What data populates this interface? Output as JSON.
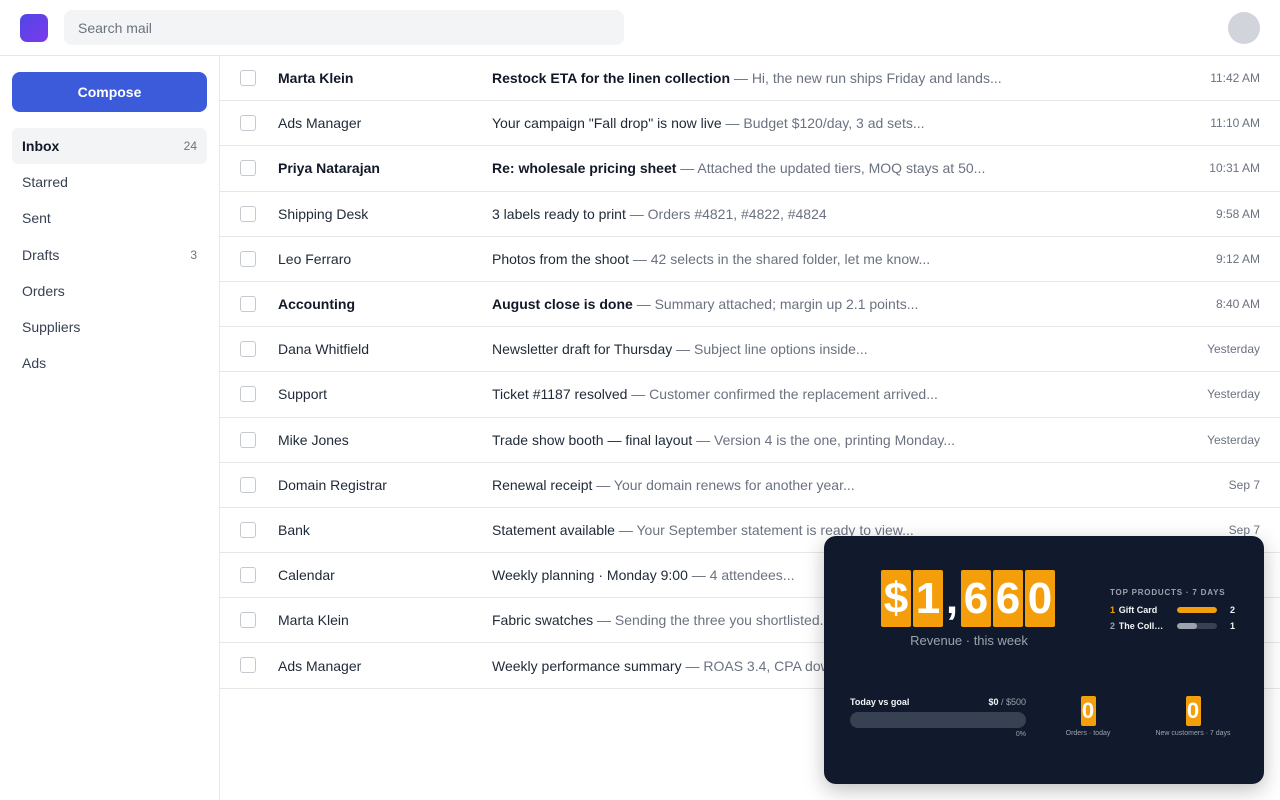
{
  "search": {
    "placeholder": "Search mail"
  },
  "sidebar": {
    "compose_label": "Compose",
    "items": [
      {
        "label": "Inbox",
        "count": "24"
      },
      {
        "label": "Starred",
        "count": ""
      },
      {
        "label": "Sent",
        "count": ""
      },
      {
        "label": "Drafts",
        "count": "3"
      },
      {
        "label": "Orders",
        "count": ""
      },
      {
        "label": "Suppliers",
        "count": ""
      },
      {
        "label": "Ads",
        "count": ""
      }
    ]
  },
  "emails": [
    {
      "sender": "Marta Klein",
      "subject": "Restock ETA for the linen collection",
      "preview": " — Hi, the new run ships Friday and lands...",
      "time": "11:42 AM",
      "unread": true
    },
    {
      "sender": "Ads Manager",
      "subject": "Your campaign \"Fall drop\" is now live",
      "preview": " — Budget $120/day, 3 ad sets...",
      "time": "11:10 AM",
      "unread": false
    },
    {
      "sender": "Priya Natarajan",
      "subject": "Re: wholesale pricing sheet",
      "preview": " — Attached the updated tiers, MOQ stays at 50...",
      "time": "10:31 AM",
      "unread": true
    },
    {
      "sender": "Shipping Desk",
      "subject": "3 labels ready to print",
      "preview": " — Orders #4821, #4822, #4824",
      "time": "9:58 AM",
      "unread": false
    },
    {
      "sender": "Leo Ferraro",
      "subject": "Photos from the shoot",
      "preview": " — 42 selects in the shared folder, let me know...",
      "time": "9:12 AM",
      "unread": false
    },
    {
      "sender": "Accounting",
      "subject": "August close is done",
      "preview": " — Summary attached; margin up 2.1 points...",
      "time": "8:40 AM",
      "unread": true
    },
    {
      "sender": "Dana Whitfield",
      "subject": "Newsletter draft for Thursday",
      "preview": " — Subject line options inside...",
      "time": "Yesterday",
      "unread": false
    },
    {
      "sender": "Support",
      "subject": "Ticket #1187 resolved",
      "preview": " — Customer confirmed the replacement arrived...",
      "time": "Yesterday",
      "unread": false
    },
    {
      "sender": "Mike Jones",
      "subject": "Trade show booth — final layout",
      "preview": " — Version 4 is the one, printing Monday...",
      "time": "Yesterday",
      "unread": false
    },
    {
      "sender": "Domain Registrar",
      "subject": "Renewal receipt",
      "preview": " — Your domain renews for another year...",
      "time": "Sep 7",
      "unread": false
    },
    {
      "sender": "Bank",
      "subject": "Statement available",
      "preview": " — Your September statement is ready to view...",
      "time": "Sep 7",
      "unread": false
    },
    {
      "sender": "Calendar",
      "subject": "Weekly planning · Monday 9:00",
      "preview": " — 4 attendees...",
      "time": "",
      "unread": false
    },
    {
      "sender": "Marta Klein",
      "subject": "Fabric swatches",
      "preview": " — Sending the three you shortlisted...",
      "time": "",
      "unread": false
    },
    {
      "sender": "Ads Manager",
      "subject": "Weekly performance summary",
      "preview": " — ROAS 3.4, CPA down...",
      "time": "",
      "unread": false
    }
  ],
  "widget": {
    "revenue": {
      "text": "$1,660",
      "label": "Revenue · this week"
    },
    "top_products": {
      "title": "TOP PRODUCTS · 7 DAYS",
      "items": [
        {
          "rank": "1",
          "name": "Gift Card",
          "value": "2",
          "share": 1.0,
          "color": "#f59e0b"
        },
        {
          "rank": "2",
          "name": "The Collection Snowboard",
          "value": "1",
          "share": 0.5,
          "color": "#9ca3af"
        }
      ]
    },
    "goal": {
      "label": "Today vs goal",
      "current": "$0",
      "total": " / $500",
      "percent_text": "0%",
      "progress": 0
    },
    "orders": {
      "value": "0",
      "label": "Orders · today"
    },
    "customers": {
      "value": "0",
      "label": "New customers · 7 days"
    }
  }
}
